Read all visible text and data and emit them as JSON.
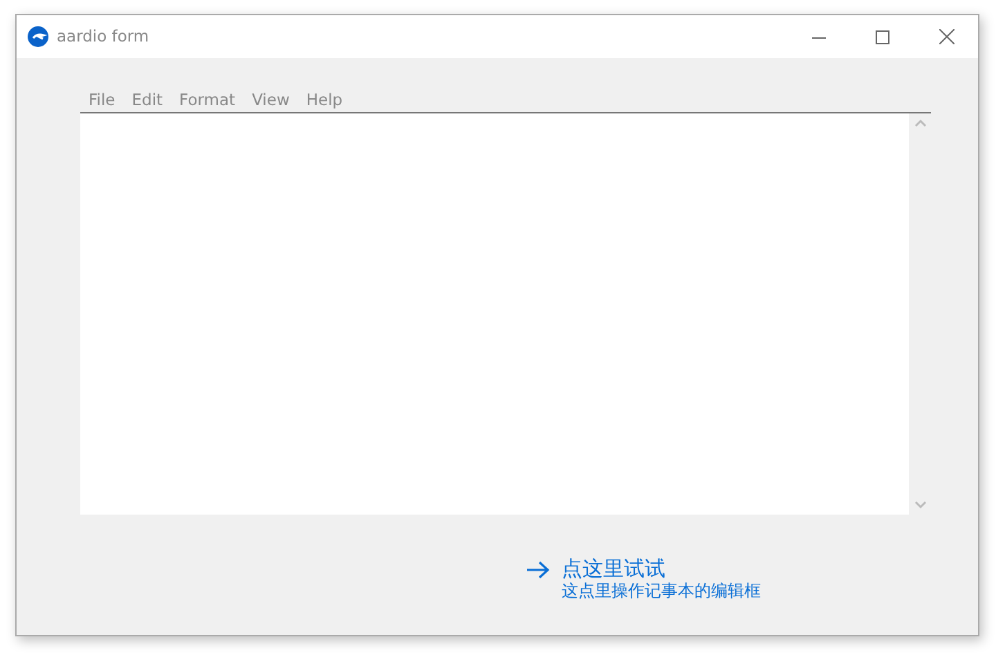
{
  "window": {
    "title": "aardio form"
  },
  "menu": [
    {
      "label": "File"
    },
    {
      "label": "Edit"
    },
    {
      "label": "Format"
    },
    {
      "label": "View"
    },
    {
      "label": "Help"
    }
  ],
  "link": {
    "title": "点这里试试",
    "subtitle": "这点里操作记事本的编辑框"
  }
}
